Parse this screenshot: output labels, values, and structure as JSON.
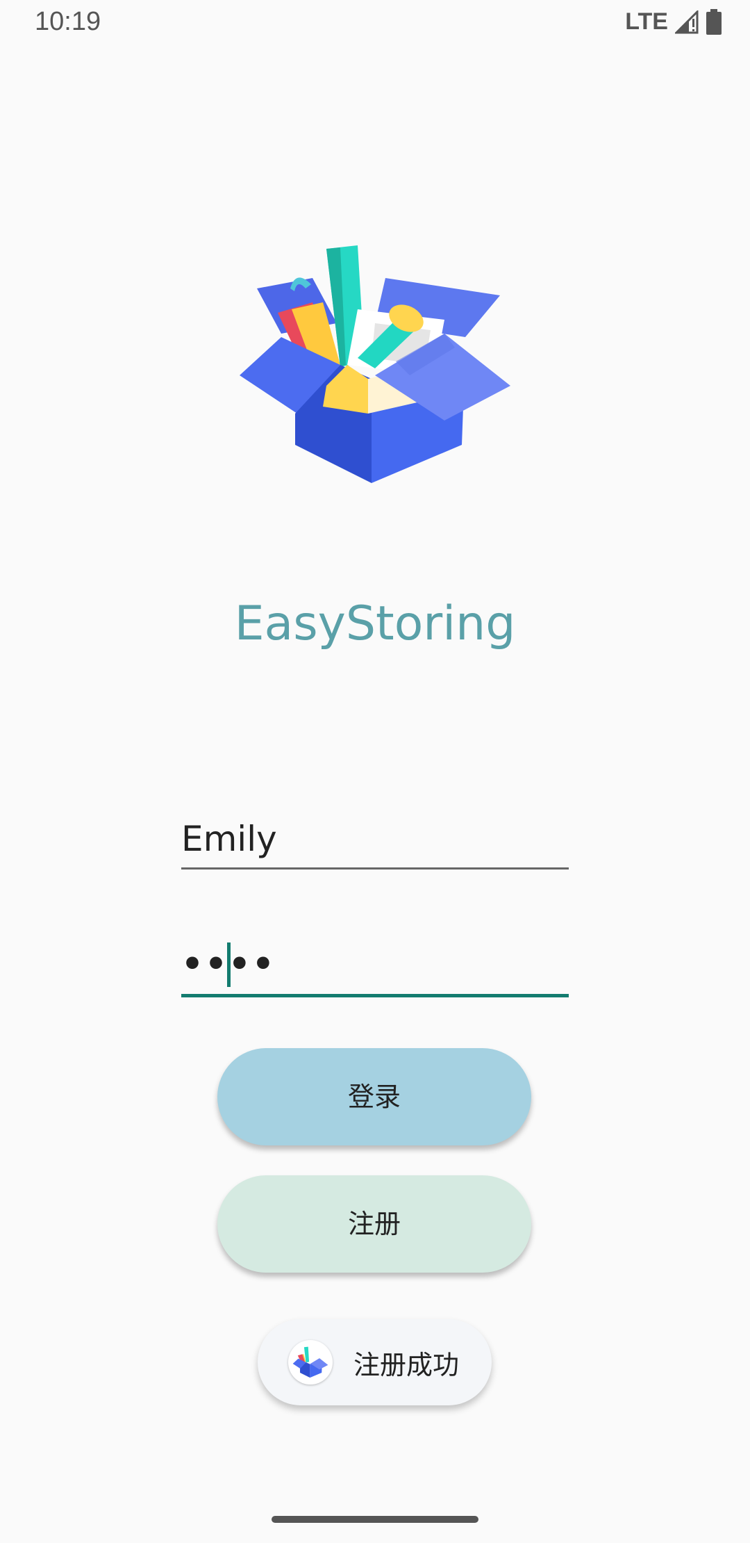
{
  "status_bar": {
    "time": "10:19",
    "network": "LTE",
    "icons": [
      "signal-icon",
      "battery-icon"
    ]
  },
  "app": {
    "title": "EasyStoring",
    "title_color": "#5aa0a8",
    "logo_icon": "storage-box-icon"
  },
  "login_form": {
    "username_value": "Emily",
    "password_value": "••••",
    "focus_color": "#137c6f"
  },
  "buttons": {
    "login_label": "登录",
    "login_color": "#a5d1e1",
    "register_label": "注册",
    "register_color": "#d5eae1"
  },
  "toast": {
    "message": "注册成功",
    "icon": "app-icon"
  }
}
